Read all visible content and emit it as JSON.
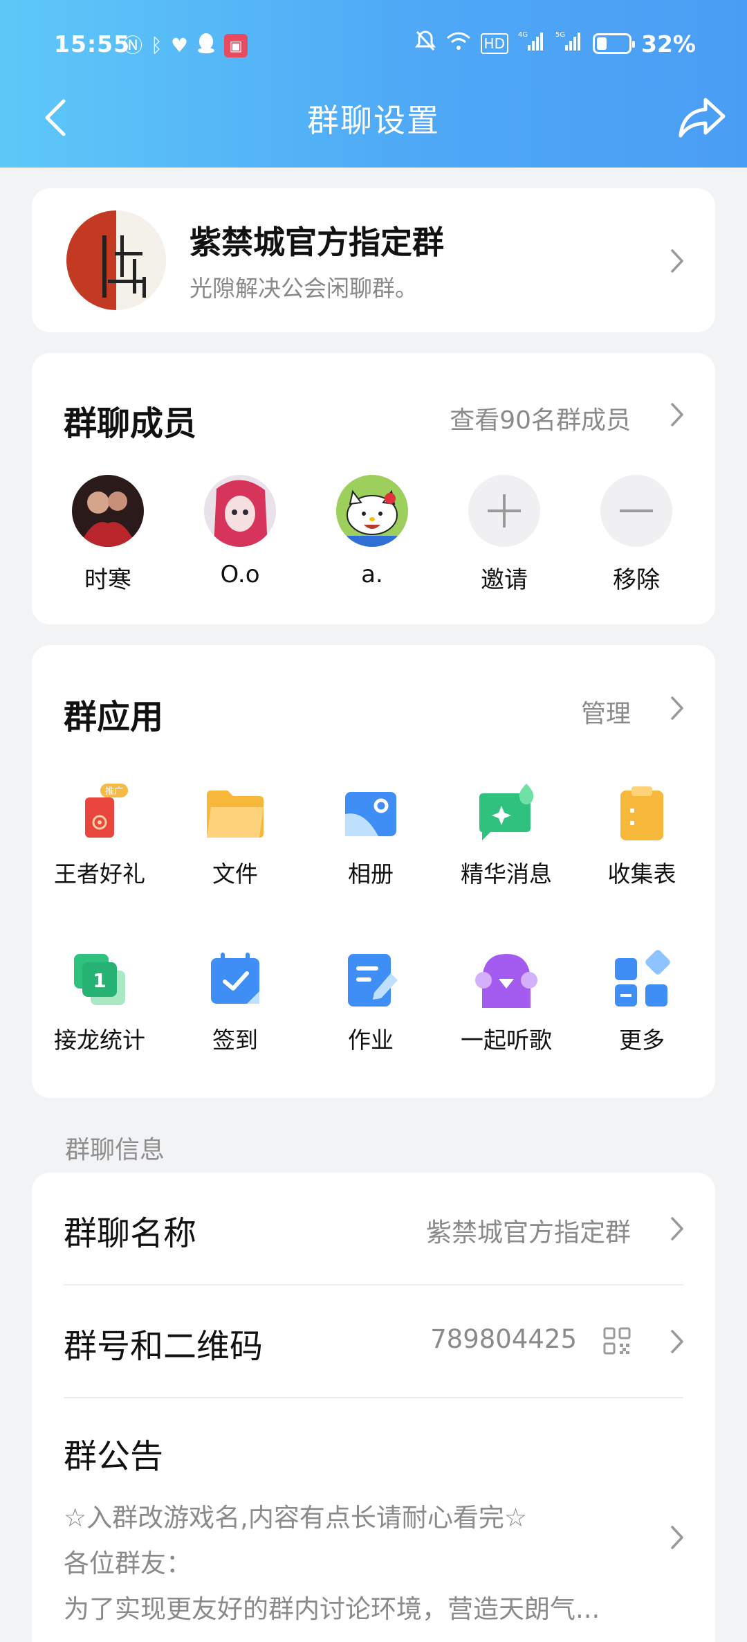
{
  "status_bar": {
    "time": "15:55",
    "left_icons": [
      "nfc-icon",
      "bluetooth-icon",
      "heart-icon",
      "qq-icon",
      "app-icon"
    ],
    "right_icons": [
      "mute-icon",
      "wifi-icon",
      "hd-icon",
      "signal-4g-icon",
      "signal-5g-icon"
    ],
    "battery_percent_text": "32%",
    "battery_level": 0.32
  },
  "nav": {
    "title": "群聊设置",
    "back_icon": "back-chevron-icon",
    "share_icon": "share-icon"
  },
  "group": {
    "name": "紫禁城官方指定群",
    "description": "光隙解决公会闲聊群。"
  },
  "members": {
    "title": "群聊成员",
    "link": "查看90名群成员",
    "list": [
      {
        "name": "时寒"
      },
      {
        "name": "O.o"
      },
      {
        "name": "a."
      }
    ],
    "invite_label": "邀请",
    "remove_label": "移除"
  },
  "apps": {
    "title": "群应用",
    "link": "管理",
    "badge": "推广",
    "items": [
      {
        "label": "王者好礼",
        "icon": "gift-icon"
      },
      {
        "label": "文件",
        "icon": "folder-icon"
      },
      {
        "label": "相册",
        "icon": "album-icon"
      },
      {
        "label": "精华消息",
        "icon": "essence-message-icon"
      },
      {
        "label": "收集表",
        "icon": "clipboard-icon"
      },
      {
        "label": "接龙统计",
        "icon": "chain-icon"
      },
      {
        "label": "签到",
        "icon": "checkin-calendar-icon"
      },
      {
        "label": "作业",
        "icon": "homework-icon"
      },
      {
        "label": "一起听歌",
        "icon": "music-bird-icon"
      },
      {
        "label": "更多",
        "icon": "grid-more-icon"
      }
    ]
  },
  "info": {
    "section_label": "群聊信息",
    "name_label": "群聊名称",
    "name_value": "紫禁城官方指定群",
    "number_label": "群号和二维码",
    "number_value": "789804425",
    "notice_label": "群公告",
    "notice_lines": [
      "☆入群改游戏名,内容有点长请耐心看完☆",
      "各位群友：",
      "为了实现更友好的群内讨论环境，营造天朗气..."
    ]
  },
  "colors": {
    "header_start": "#5ec8f8",
    "header_end": "#4a9df4",
    "background": "#f2f3f5"
  }
}
